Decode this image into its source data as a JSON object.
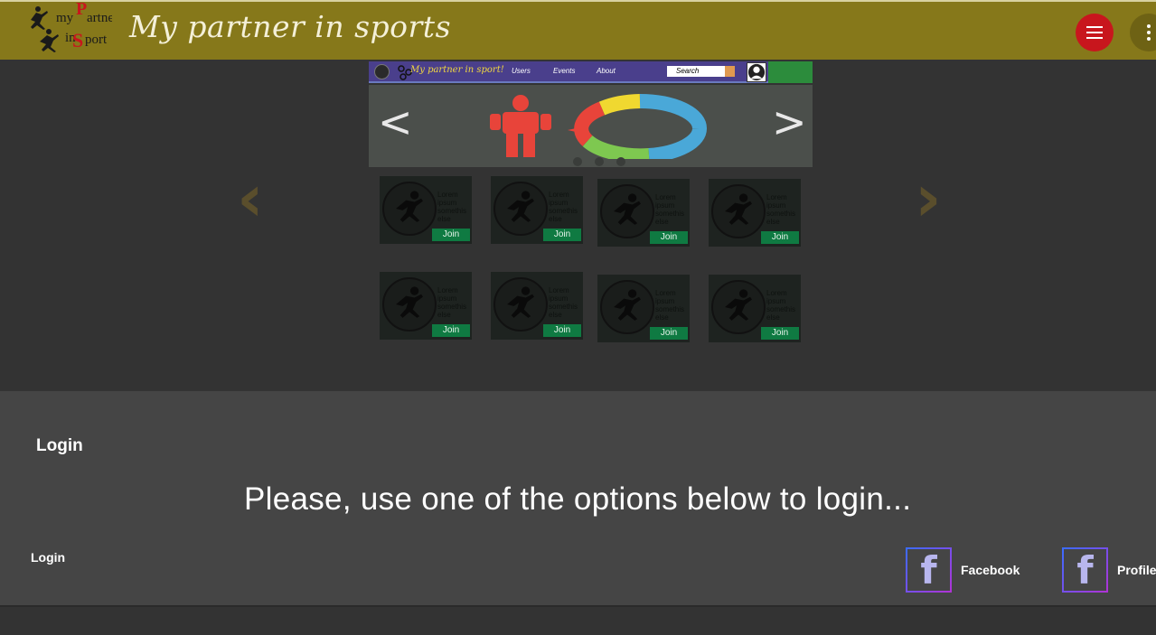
{
  "header": {
    "logo_text": "my Partner in Sport",
    "title": "My partner in sports",
    "menu_icon": "hamburger-icon",
    "more_icon": "more-vertical-icon"
  },
  "carousel": {
    "prev_icon": "chevron-left-icon",
    "next_icon": "chevron-right-icon",
    "slide_indicators": 3
  },
  "preview": {
    "brand": "My partner in sport!",
    "nav": [
      "Users",
      "Events",
      "About"
    ],
    "search_placeholder": "Search",
    "prev_label": "<",
    "next_label": ">"
  },
  "cards": [
    {
      "text": "Lorem ipsum somethis else",
      "button": "Join"
    },
    {
      "text": "Lorem ipsum somethis else",
      "button": "Join"
    },
    {
      "text": "Lorem ipsum somethis else",
      "button": "Join"
    },
    {
      "text": "Lorem ipsum somethis else",
      "button": "Join"
    },
    {
      "text": "Lorem ipsum somethis else",
      "button": "Join"
    },
    {
      "text": "Lorem ipsum somethis else",
      "button": "Join"
    },
    {
      "text": "Lorem ipsum somethis else",
      "button": "Join"
    },
    {
      "text": "Lorem ipsum somethis else",
      "button": "Join"
    }
  ],
  "login": {
    "title": "Login",
    "message": "Please, use one of the options below to login...",
    "sub_label": "Login",
    "options": [
      {
        "label": "Facebook",
        "icon": "facebook-icon"
      },
      {
        "label": "Profile",
        "icon": "facebook-icon"
      }
    ]
  },
  "colors": {
    "header": "#86781a",
    "menu_button": "#c8161d",
    "join_button": "#0f7a42",
    "panel": "#454545"
  }
}
